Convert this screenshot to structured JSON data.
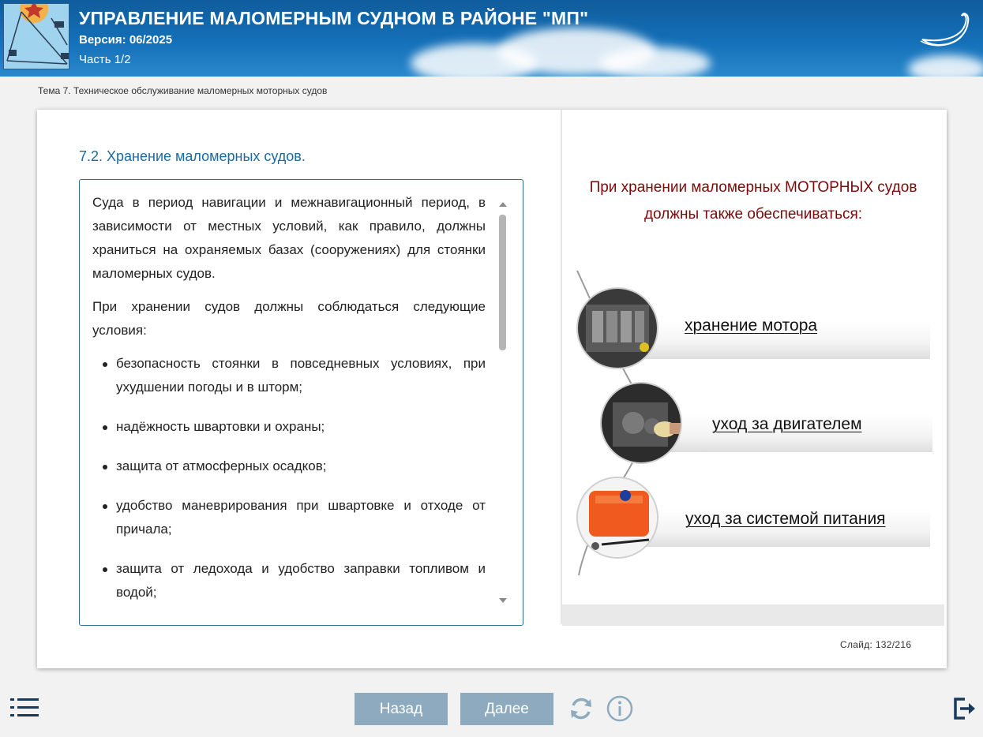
{
  "header": {
    "title": "УПРАВЛЕНИЕ МАЛОМЕРНЫМ СУДНОМ В РАЙОНЕ \"МП\"",
    "version": "Версия: 06/2025",
    "part": "Часть 1/2",
    "brand_logo": "Storm"
  },
  "breadcrumb": "Тема 7. Техническое обслуживание маломерных моторных судов",
  "section_title": "7.2. Хранение маломерных судов.",
  "text": {
    "p1": "Суда в период навигации и межнавигационный период, в зависимости от местных условий, как правило, должны храниться на охраняемых базах (сооружениях) для стоянки маломерных судов.",
    "p2": "При хранении судов должны соблюдаться следующие условия:",
    "bullets": [
      "безопасность стоянки в повседневных условиях, при ухудшении погоды и в шторм;",
      "надёжность швартовки и охраны;",
      "защита от атмосферных осадков;",
      "удобство маневрирования при швартовке и отходе от причала;",
      "защита от ледохода и удобство заправки топливом и водой;"
    ]
  },
  "right": {
    "heading_line1": "При хранении маломерных МОТОРНЫХ судов",
    "heading_line2": "должны также обеспечиваться:",
    "items": [
      {
        "label": "хранение мотора"
      },
      {
        "label": "уход за двигателем"
      },
      {
        "label": "уход за системой питания"
      }
    ]
  },
  "slide_counter": "Слайд:  132/216",
  "footer": {
    "back_label": "Назад",
    "next_label": "Далее"
  },
  "colors": {
    "header_blue": "#1470b8",
    "section_title": "#1b6aa0",
    "right_heading": "#7a0a0a",
    "nav_button": "#8eaabf"
  }
}
